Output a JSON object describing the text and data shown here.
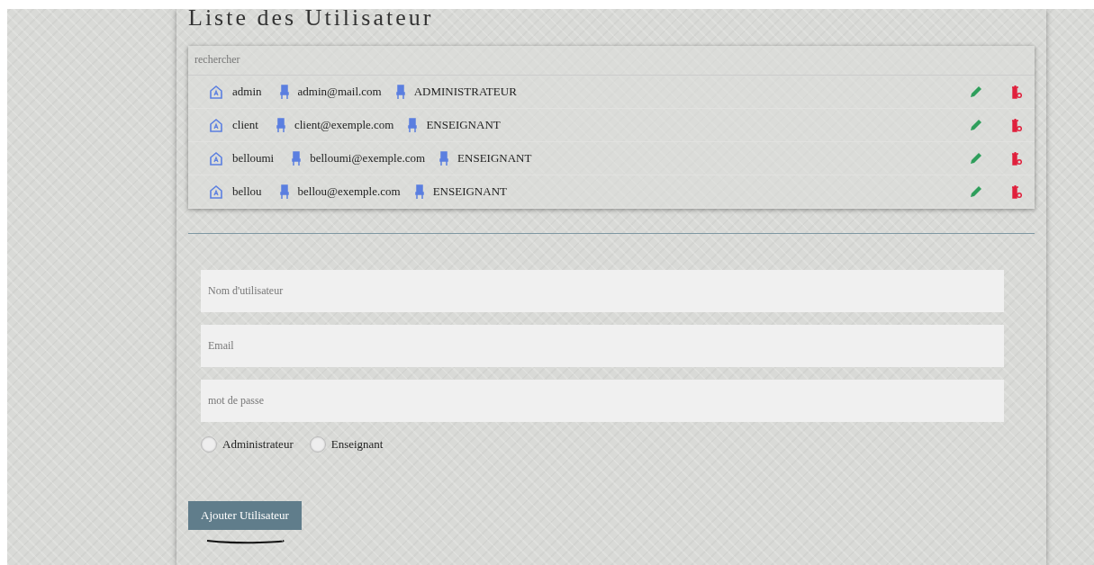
{
  "title": "Liste des Utilisateur",
  "search": {
    "placeholder": "rechercher"
  },
  "users": [
    {
      "name": "admin",
      "email": "admin@mail.com",
      "role": "ADMINISTRATEUR"
    },
    {
      "name": "client",
      "email": "client@exemple.com",
      "role": "ENSEIGNANT"
    },
    {
      "name": "belloumi",
      "email": "belloumi@exemple.com",
      "role": "ENSEIGNANT"
    },
    {
      "name": "bellou",
      "email": "bellou@exemple.com",
      "role": "ENSEIGNANT"
    }
  ],
  "fields": [
    {
      "placeholder": "Nom d'utilisateur"
    },
    {
      "placeholder": "Email"
    },
    {
      "placeholder": "mot de passe"
    }
  ],
  "roles": [
    {
      "label": "Administrateur",
      "selected": false
    },
    {
      "label": "Enseignant",
      "selected": false
    }
  ],
  "submit": "Ajouter Utilisateur"
}
